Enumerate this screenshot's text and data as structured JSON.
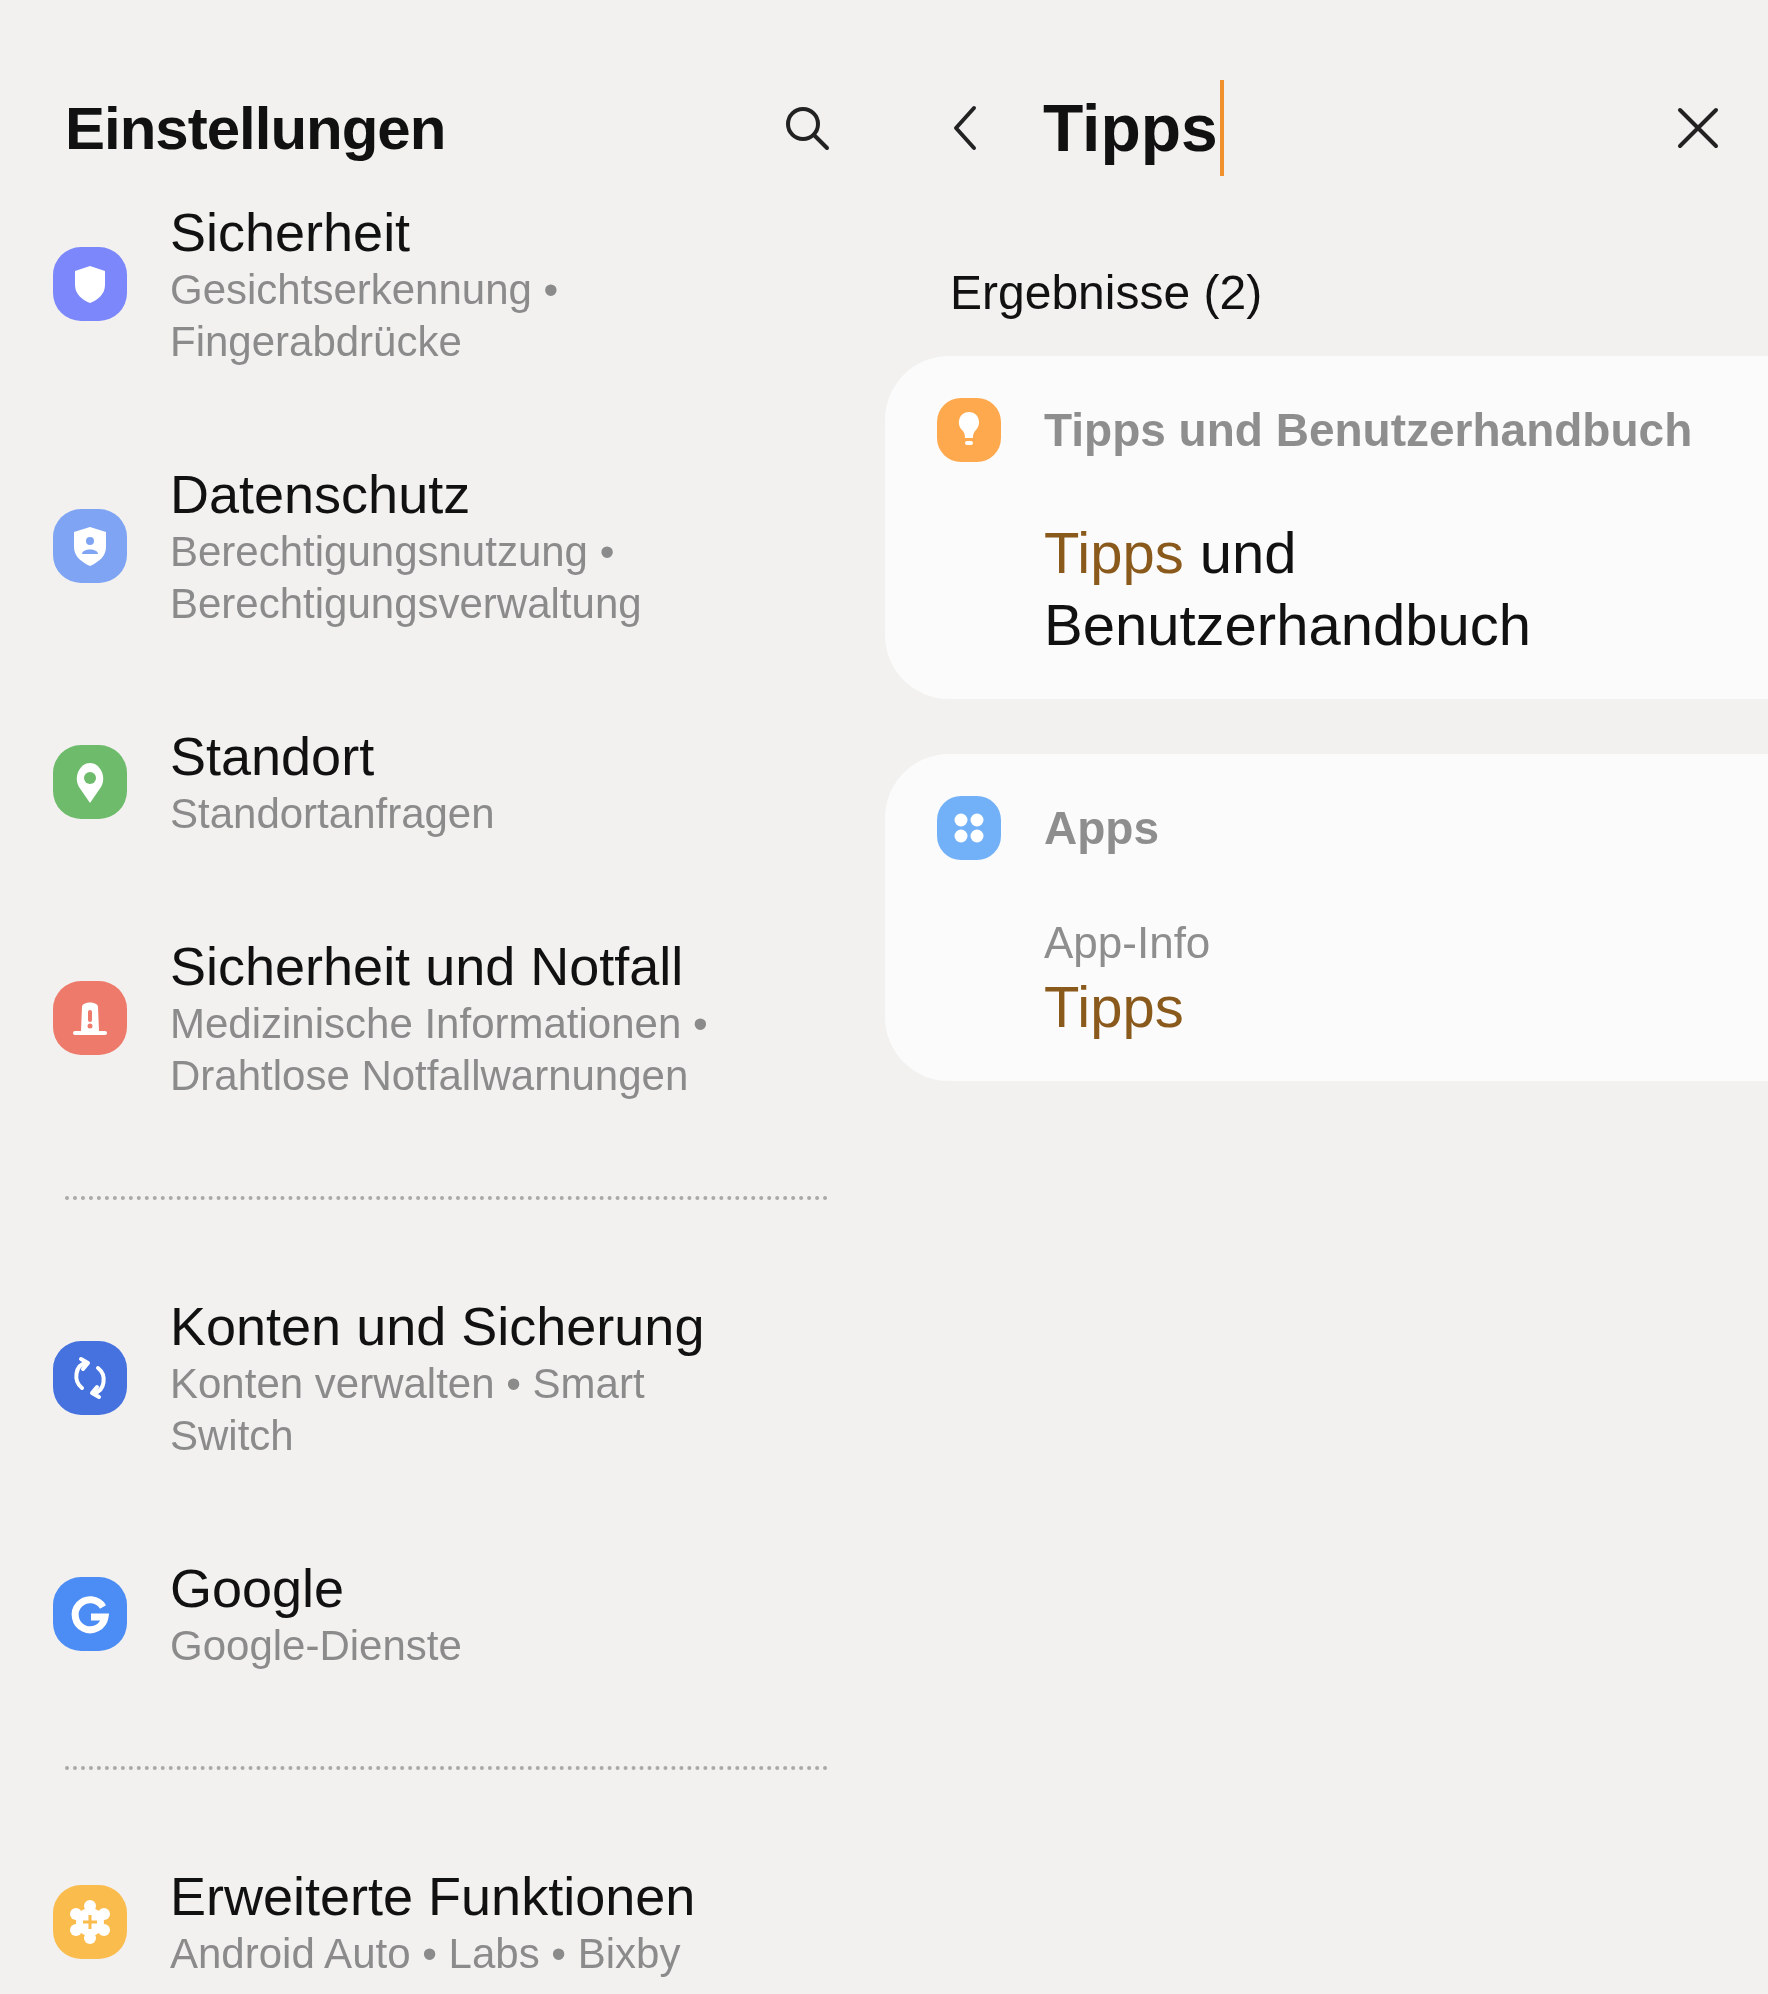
{
  "settings": {
    "title": "Einstellungen",
    "groups": [
      {
        "items": [
          {
            "title": "Sicherheit",
            "subtitle": "Gesichtserkennung • Fingerabdrücke",
            "kind": "shield",
            "color": "#7b87fb"
          },
          {
            "title": "Datenschutz",
            "subtitle": "Berechtigungsnutzung • Berechtigungsverwaltung",
            "kind": "privacy",
            "color": "#7ea4f3"
          },
          {
            "title": "Standort",
            "subtitle": "Standortanfragen",
            "kind": "pin",
            "color": "#6dbb6b"
          },
          {
            "title": "Sicherheit und Notfall",
            "subtitle": "Medizinische Informationen • Drahtlose Notfallwarnungen",
            "kind": "siren",
            "color": "#ee7a6b"
          }
        ]
      },
      {
        "items": [
          {
            "title": "Konten und Sicherung",
            "subtitle": "Konten verwalten • Smart Switch",
            "kind": "sync",
            "color": "#4672e0"
          },
          {
            "title": "Google",
            "subtitle": "Google-Dienste",
            "kind": "google",
            "color": "#4b8cf5"
          }
        ]
      },
      {
        "items": [
          {
            "title": "Erweiterte Funktionen",
            "subtitle": "Android Auto • Labs • Bixby",
            "kind": "gear",
            "color": "#fbbc4e"
          }
        ]
      }
    ]
  },
  "search": {
    "value": "Tipps",
    "results_label": "Ergebnisse (2)",
    "results": [
      {
        "category": "Tipps und Benutzerhandbuch",
        "kind": "bulb",
        "color": "#fea94e",
        "title_parts": [
          {
            "text": "Tipps",
            "highlighted": true
          },
          {
            "text": " und Benutzerhandbuch",
            "highlighted": false
          }
        ]
      },
      {
        "category": "Apps",
        "kind": "apps",
        "color": "#72b1f7",
        "path": "App-Info",
        "title_parts": [
          {
            "text": "Tipps",
            "highlighted": true
          }
        ]
      }
    ]
  }
}
